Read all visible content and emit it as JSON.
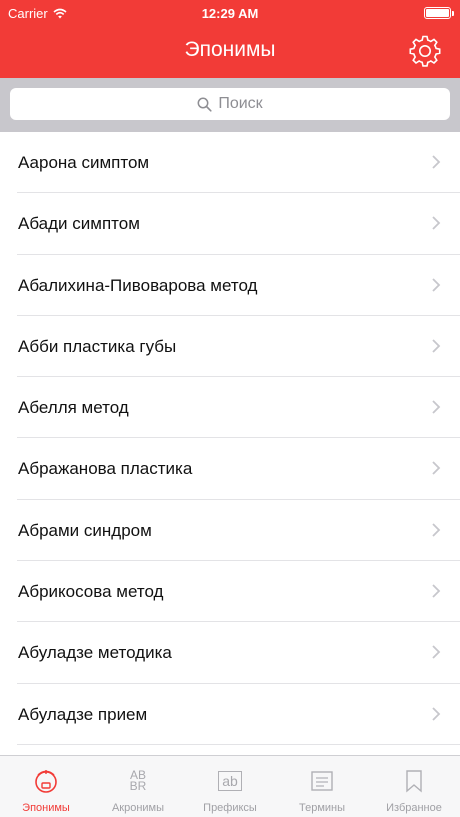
{
  "status": {
    "carrier": "Carrier",
    "time": "12:29 AM"
  },
  "nav": {
    "title": "Эпонимы",
    "settings_icon": "gear-icon"
  },
  "search": {
    "placeholder": "Поиск"
  },
  "colors": {
    "accent": "#f23b37",
    "search_bg": "#c8c7cc",
    "separator": "#e3e3e6"
  },
  "list": {
    "items": [
      {
        "label": "Аарона симптом"
      },
      {
        "label": "Абади симптом"
      },
      {
        "label": "Абалихина-Пивоварова метод"
      },
      {
        "label": "Абби пластика губы"
      },
      {
        "label": "Абелля метод"
      },
      {
        "label": "Абражанова пластика"
      },
      {
        "label": "Абрами синдром"
      },
      {
        "label": "Абрикосова метод"
      },
      {
        "label": "Абуладзе методика"
      },
      {
        "label": "Абуладзе прием"
      }
    ]
  },
  "tabs": [
    {
      "label": "Эпонимы",
      "icon": "doctor-icon",
      "active": true
    },
    {
      "label": "Акронимы",
      "icon": "abbreviation-icon",
      "icon_text_top": "AB",
      "icon_text_bottom": "BR"
    },
    {
      "label": "Префиксы",
      "icon": "prefix-icon",
      "icon_text": "ab"
    },
    {
      "label": "Термины",
      "icon": "terms-icon"
    },
    {
      "label": "Избранное",
      "icon": "bookmark-icon"
    }
  ]
}
